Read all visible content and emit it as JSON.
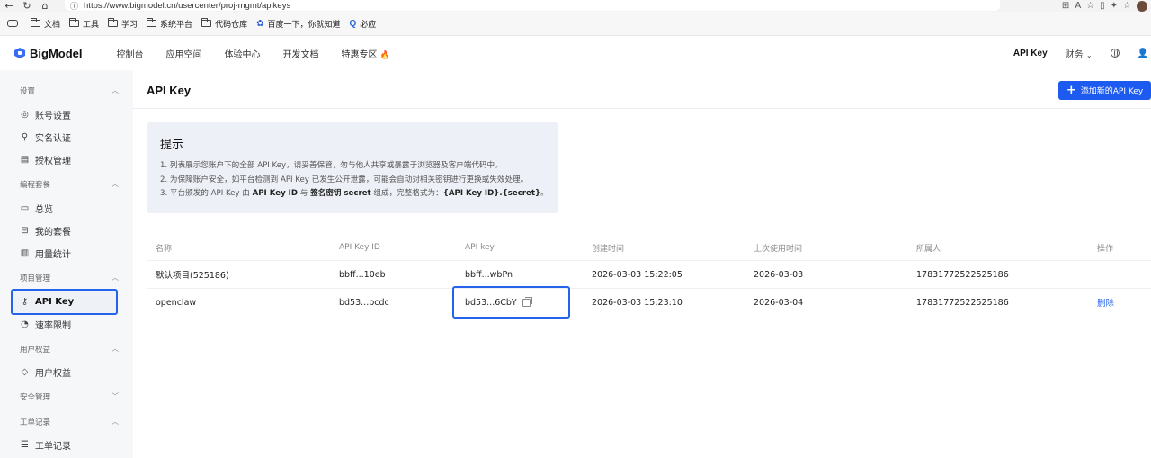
{
  "browser": {
    "url": "https://www.bigmodel.cn/usercenter/proj-mgmt/apikeys",
    "bookmarks": [
      "文档",
      "工具",
      "学习",
      "系统平台",
      "代码仓库",
      "百度一下，你就知道",
      "必应"
    ]
  },
  "header": {
    "logo": "BigModel",
    "nav": [
      "控制台",
      "应用空间",
      "体验中心",
      "开发文档",
      "特惠专区"
    ],
    "right_apikey": "API Key",
    "right_finance": "财务"
  },
  "sidebar": {
    "groups": [
      {
        "label": "设置",
        "items": [
          "账号设置",
          "实名认证",
          "授权管理"
        ]
      },
      {
        "label": "编程套餐",
        "items": [
          "总览",
          "我的套餐",
          "用量统计"
        ]
      },
      {
        "label": "项目管理",
        "items": [
          "API Key",
          "速率限制"
        ]
      },
      {
        "label": "用户权益",
        "items": [
          "用户权益"
        ]
      },
      {
        "label": "安全管理",
        "items": []
      },
      {
        "label": "工单记录",
        "items": [
          "工单记录"
        ]
      }
    ],
    "active": "API Key"
  },
  "main": {
    "title": "API Key",
    "add_button": "添加新的API Key",
    "tip": {
      "title": "提示",
      "line1": "1. 列表展示您账户下的全部 API Key，请妥善保管，勿与他人共享或暴露于浏览器及客户端代码中。",
      "line2": "2. 为保障账户安全，如平台检测到 API Key 已发生公开泄露，可能会自动对相关密钥进行更换或失效处理。",
      "line3_a": "3. 平台颁发的 API Key 由 ",
      "line3_b": "API Key ID",
      "line3_c": " 与 ",
      "line3_d": "签名密钥 secret",
      "line3_e": " 组成，完整格式为：",
      "line3_f": "{API Key ID}.{secret}",
      "line3_g": "。"
    },
    "table": {
      "headers": [
        "名称",
        "API Key ID",
        "API key",
        "创建时间",
        "上次使用时间",
        "所属人",
        "操作"
      ],
      "rows": [
        {
          "name": "默认项目(525186)",
          "key_id": "bbff...10eb",
          "key": "bbff...wbPn",
          "created": "2026-03-03 15:22:05",
          "last_used": "2026-03-03",
          "owner": "17831772522525186",
          "action": ""
        },
        {
          "name": "openclaw",
          "key_id": "bd53...bcdc",
          "key": "bd53...6CbY",
          "created": "2026-03-03 15:23:10",
          "last_used": "2026-03-04",
          "owner": "17831772522525186",
          "action": "删除"
        }
      ]
    }
  }
}
